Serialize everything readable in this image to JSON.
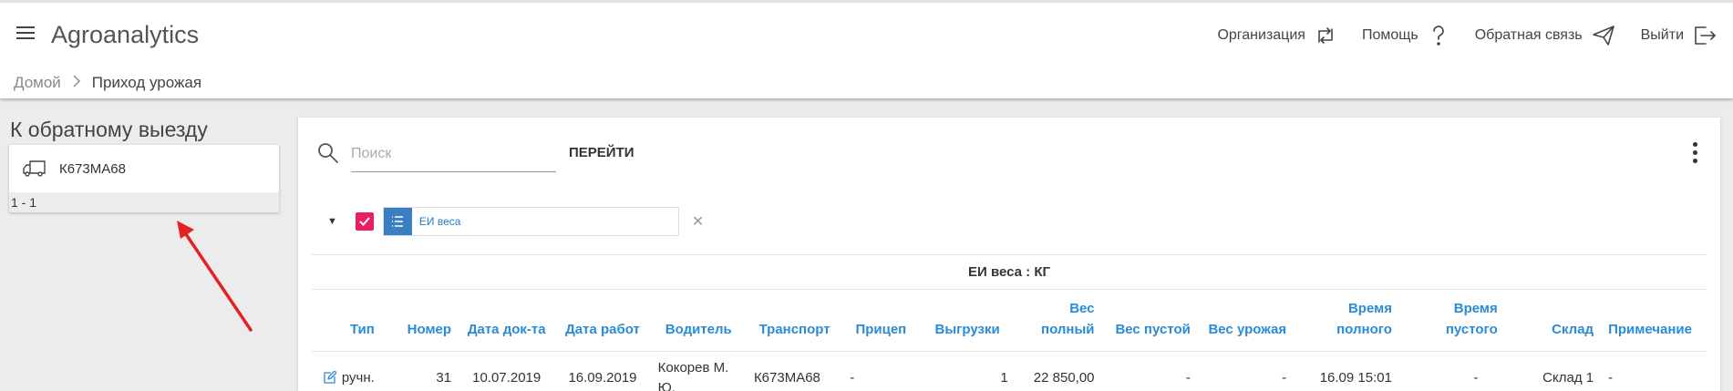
{
  "header": {
    "app_title": "Agroanalytics",
    "actions": [
      {
        "label": "Организация",
        "icon": "sync-icon"
      },
      {
        "label": "Помощь",
        "icon": "help-icon"
      },
      {
        "label": "Обратная связь",
        "icon": "send-icon"
      },
      {
        "label": "Выйти",
        "icon": "logout-icon"
      }
    ]
  },
  "breadcrumb": {
    "home": "Домой",
    "current": "Приход урожая"
  },
  "left_panel": {
    "title": "К обратному выезду",
    "vehicle_plate": "К673МА68",
    "pagination": "1 - 1"
  },
  "search": {
    "placeholder": "Поиск",
    "go_label": "ПЕРЕЙТИ"
  },
  "filter": {
    "chip_label": "ЕИ веса",
    "checked": true
  },
  "table": {
    "group_label": "ЕИ веса : КГ",
    "columns": [
      "Тип",
      "Номер",
      "Дата док-та",
      "Дата работ",
      "Водитель",
      "Транспорт",
      "Прицеп",
      "Выгрузки",
      "Вес полный",
      "Вес пустой",
      "Вес урожая",
      "Время полного",
      "Время пустого",
      "Склад",
      "Примечание"
    ],
    "rows": [
      {
        "type": "ручн.",
        "number": "31",
        "doc_date": "10.07.2019",
        "work_date": "16.09.2019",
        "driver": "Кокорев М. Ю.",
        "transport": "К673МА68",
        "trailer": "-",
        "unloads": "1",
        "weight_full": "22 850,00",
        "weight_empty": "-",
        "weight_crop": "-",
        "time_full": "16.09 15:01",
        "time_empty": "-",
        "warehouse": "Склад 1",
        "note": "-"
      }
    ]
  },
  "colors": {
    "accent": "#2a8bd6",
    "checkbox": "#e91e63",
    "chip_icon_bg": "#3a7fc1",
    "annotation_arrow": "#e52222"
  }
}
